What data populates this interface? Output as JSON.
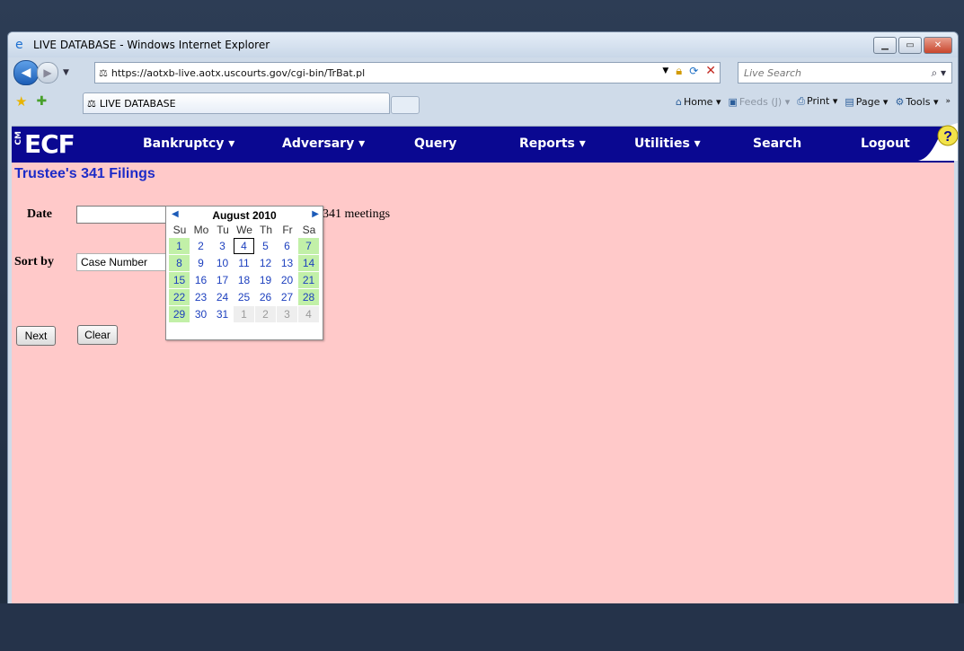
{
  "browser": {
    "title": "LIVE DATABASE - Windows Internet Explorer",
    "url": "https://aotxb-live.aotx.uscourts.gov/cgi-bin/TrBat.pl",
    "search_placeholder": "Live Search",
    "tab_label": "LIVE DATABASE",
    "commands": {
      "home": "Home",
      "feeds": "Feeds (J)",
      "print": "Print",
      "page": "Page",
      "tools": "Tools"
    }
  },
  "ecf": {
    "logo": "ECF",
    "logo_prefix": "CM",
    "menu": [
      {
        "label": "Bankruptcy ▾"
      },
      {
        "label": "Adversary ▾"
      },
      {
        "label": "Query"
      },
      {
        "label": "Reports ▾"
      },
      {
        "label": "Utilities ▾"
      },
      {
        "label": "Search"
      },
      {
        "label": "Logout"
      }
    ],
    "help_glyph": "?"
  },
  "page": {
    "title": "Trustee's 341 Filings",
    "date_label": "Date",
    "date_value": "",
    "meetings_text": "341 meetings",
    "sort_label": "Sort by",
    "sort_value": "Case Number",
    "next_button": "Next",
    "clear_button": "Clear"
  },
  "calendar": {
    "month_label": "August 2010",
    "days_of_week": [
      "Su",
      "Mo",
      "Tu",
      "We",
      "Th",
      "Fr",
      "Sa"
    ],
    "today": "4",
    "weeks": [
      [
        "1",
        "2",
        "3",
        "4",
        "5",
        "6",
        "7"
      ],
      [
        "8",
        "9",
        "10",
        "11",
        "12",
        "13",
        "14"
      ],
      [
        "15",
        "16",
        "17",
        "18",
        "19",
        "20",
        "21"
      ],
      [
        "22",
        "23",
        "24",
        "25",
        "26",
        "27",
        "28"
      ],
      [
        "29",
        "30",
        "31",
        "1",
        "2",
        "3",
        "4"
      ]
    ]
  }
}
